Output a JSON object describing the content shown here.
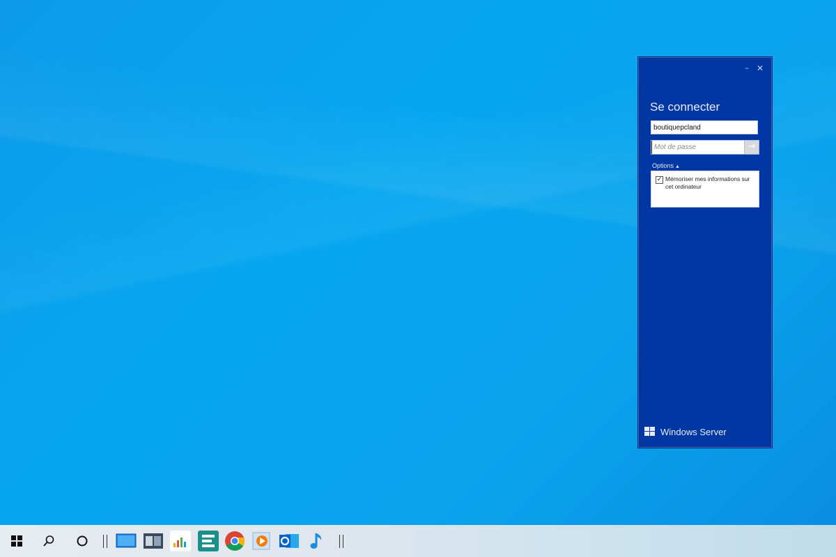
{
  "login": {
    "title": "Se connecter",
    "username_value": "boutiquepcland",
    "password_placeholder": "Mot de passe",
    "submit_arrow": "→",
    "options_label": "Options",
    "options_caret": "▲",
    "remember_checked_mark": "✓",
    "remember_label": "Mémoriser mes informations sur cet ordinateur",
    "brand_text": "Windows Server",
    "minimize_glyph": "–",
    "close_glyph": "✕"
  },
  "taskbar": {
    "apps": [
      {
        "name": "remote-desktop-icon",
        "color": "#1e88e5"
      },
      {
        "name": "task-view-app-icon",
        "color": "#3a4a5a"
      },
      {
        "name": "equalizer-icon",
        "color": "#f5a623"
      },
      {
        "name": "menu-app-icon",
        "color": "#1b8f8a"
      },
      {
        "name": "chrome-icon",
        "color": "#db4437"
      },
      {
        "name": "media-player-icon",
        "color": "#f57c00"
      },
      {
        "name": "outlook-icon",
        "color": "#0a64c8"
      },
      {
        "name": "music-note-icon",
        "color": "#1a8de0"
      }
    ]
  }
}
